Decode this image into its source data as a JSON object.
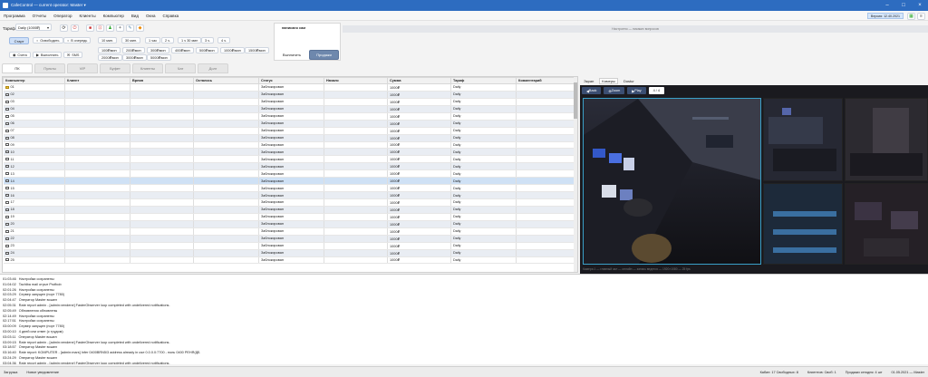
{
  "window": {
    "title": "CafeControl — current operator: Master ▾"
  },
  "menu": [
    "Программа",
    "Отчеты",
    "Оператор",
    "Клиенты",
    "Компьютер",
    "Вид",
    "Окна",
    "Справка"
  ],
  "toolbar": {
    "tariff_label": "Тариф",
    "tariff_value": "Daily (1000₽)",
    "btn_start": "Старт",
    "btn_free": "Освободить",
    "btn_pause": "В очередь",
    "btn_score": "Счета",
    "btn_move": "Выполнить",
    "btn_sms": "SMS",
    "time_chips": [
      "10 мин.",
      "30 мин.",
      "1 час",
      "2 ч.",
      "1 ч 30 мин",
      "3 ч.",
      "4 ч."
    ],
    "amount_chips": [
      "100₽/мин",
      "200₽/мин",
      "300₽/мин",
      "400₽/мин",
      "500₽/мин",
      "1000₽/мин",
      "1500₽/мин",
      "2000₽/мин",
      "3000₽/мин",
      "5000₽/мин"
    ],
    "notice_title": "написано сам",
    "btn_fines": "Выплатить",
    "btn_sell": "Продажи",
    "version_badge": "Версия: 12.40.2021",
    "banner_text": "Настроено — никаких вопросов",
    "colors": {
      "accent": "#2d6cc0",
      "banner": "#e4e6ea"
    }
  },
  "tabs": [
    "ПК",
    "Пульты",
    "VIP",
    "Буфет",
    "Клиенты",
    "Чат",
    "Долг"
  ],
  "grid": {
    "columns": [
      "Компьютер",
      "Клиент",
      "Время",
      "Осталось",
      "Статус",
      "Начало",
      "Сумма",
      "Тариф",
      "Комментарий"
    ],
    "rows": [
      {
        "pc": "01",
        "status": "Заблокирован",
        "sum": "1000₽",
        "tariff": "Daily",
        "warn": true
      },
      {
        "pc": "02",
        "status": "Заблокирован",
        "sum": "1000₽",
        "tariff": "Daily"
      },
      {
        "pc": "03",
        "status": "Заблокирован",
        "sum": "1000₽",
        "tariff": "Daily"
      },
      {
        "pc": "04",
        "status": "Заблокирован",
        "sum": "1000₽",
        "tariff": "Daily"
      },
      {
        "pc": "05",
        "status": "Заблокирован",
        "sum": "1000₽",
        "tariff": "Daily"
      },
      {
        "pc": "06",
        "status": "Заблокирован",
        "sum": "1000₽",
        "tariff": "Daily"
      },
      {
        "pc": "07",
        "status": "Заблокирован",
        "sum": "1000₽",
        "tariff": "Daily"
      },
      {
        "pc": "08",
        "status": "Заблокирован",
        "sum": "1000₽",
        "tariff": "Daily"
      },
      {
        "pc": "09",
        "status": "Заблокирован",
        "sum": "1000₽",
        "tariff": "Daily"
      },
      {
        "pc": "10",
        "status": "Заблокирован",
        "sum": "1000₽",
        "tariff": "Daily"
      },
      {
        "pc": "11",
        "status": "Заблокирован",
        "sum": "1000₽",
        "tariff": "Daily"
      },
      {
        "pc": "12",
        "status": "Заблокирован",
        "sum": "1000₽",
        "tariff": "Daily"
      },
      {
        "pc": "13",
        "status": "Заблокирован",
        "sum": "1000₽",
        "tariff": "Daily"
      },
      {
        "pc": "14",
        "status": "Заблокирован",
        "sum": "1000₽",
        "tariff": "Daily",
        "selected": true
      },
      {
        "pc": "15",
        "status": "Заблокирован",
        "sum": "1000₽",
        "tariff": "Daily"
      },
      {
        "pc": "16",
        "status": "Заблокирован",
        "sum": "1000₽",
        "tariff": "Daily"
      },
      {
        "pc": "17",
        "status": "Заблокирован",
        "sum": "1000₽",
        "tariff": "Daily"
      },
      {
        "pc": "18",
        "status": "Заблокирован",
        "sum": "1000₽",
        "tariff": "Daily"
      },
      {
        "pc": "19",
        "status": "Заблокирован",
        "sum": "1000₽",
        "tariff": "Daily"
      },
      {
        "pc": "20",
        "status": "Заблокирован",
        "sum": "1000₽",
        "tariff": "Daily"
      },
      {
        "pc": "21",
        "status": "Заблокирован",
        "sum": "1000₽",
        "tariff": "Daily"
      },
      {
        "pc": "22",
        "status": "Заблокирован",
        "sum": "1000₽",
        "tariff": "Daily"
      },
      {
        "pc": "23",
        "status": "Заблокирован",
        "sum": "1000₽",
        "tariff": "Daily"
      },
      {
        "pc": "24",
        "status": "Заблокирован",
        "sum": "1000₽",
        "tariff": "Daily"
      },
      {
        "pc": "25",
        "status": "Заблокирован",
        "sum": "1000₽",
        "tariff": "Daily"
      }
    ]
  },
  "camera": {
    "tabs": [
      "Экран",
      "Камеры",
      "Dostur"
    ],
    "buttons": [
      "Back",
      "Zoom",
      "Play",
      "4 / 4"
    ],
    "caption": "Камера 1 — главный зал — онлайн — запись ведется — 1920×1080 — 25 fps"
  },
  "log": [
    {
      "t": "01:03:46",
      "msg": "Настройки сохранены"
    },
    {
      "t": "01:04:02",
      "msg": "Tachiba mail отрыт Profbob"
    },
    {
      "t": "02:01:26",
      "msg": "Настройки сохранены"
    },
    {
      "t": "02:03:29",
      "msg": "Сервер запущен (порт 7780)"
    },
    {
      "t": "02:04:47",
      "msg": "Оператор Master вошел"
    },
    {
      "t": "02:05:31",
      "msg": "Rate report admin - [admin:vendene] FasterObserver loop completed with undelivered notifications."
    },
    {
      "t": "02:05:49",
      "msg": "Обновления обновлены"
    },
    {
      "t": "02:14:49",
      "msg": "Настройки сохранены"
    },
    {
      "t": "02:17:51",
      "msg": "Настройки сохранены"
    },
    {
      "t": "03:00:09",
      "msg": "Сервер запущен (порт 7780)"
    },
    {
      "t": "03:00:10",
      "msg": "4 дней или ответ (с трудом)"
    },
    {
      "t": "03:03:11",
      "msg": "Оператор Master вошел"
    },
    {
      "t": "03:09:15",
      "msg": "Rate report admin - [admin:vendene] FasterObserver loop completed with undelivered notifications."
    },
    {
      "t": "03:18:57",
      "msg": "Оператор Master вошел"
    },
    {
      "t": "03:16:40",
      "msg": "Rate report: KOMPUTER - [admin:mars] Infer 0400BRN5/3 address already in use 0.0.0.0:7700 - ноль 0400 РЕНЯ/ДБ"
    },
    {
      "t": "03:24:29",
      "msg": "Оператор Master вошел"
    },
    {
      "t": "03:04:36",
      "msg": "Rate report admin - [admin:vendene] FasterObserver loop completed with undelivered notifications."
    }
  ],
  "status": {
    "left": "Загрузка",
    "left2": "Новое уведомление",
    "items": [
      "Кабин: 17 Свободных: 8",
      "Клиентов: Своб: 1",
      "Продажи сегодня: 4 шт",
      "01.05.2021 — Master"
    ]
  }
}
